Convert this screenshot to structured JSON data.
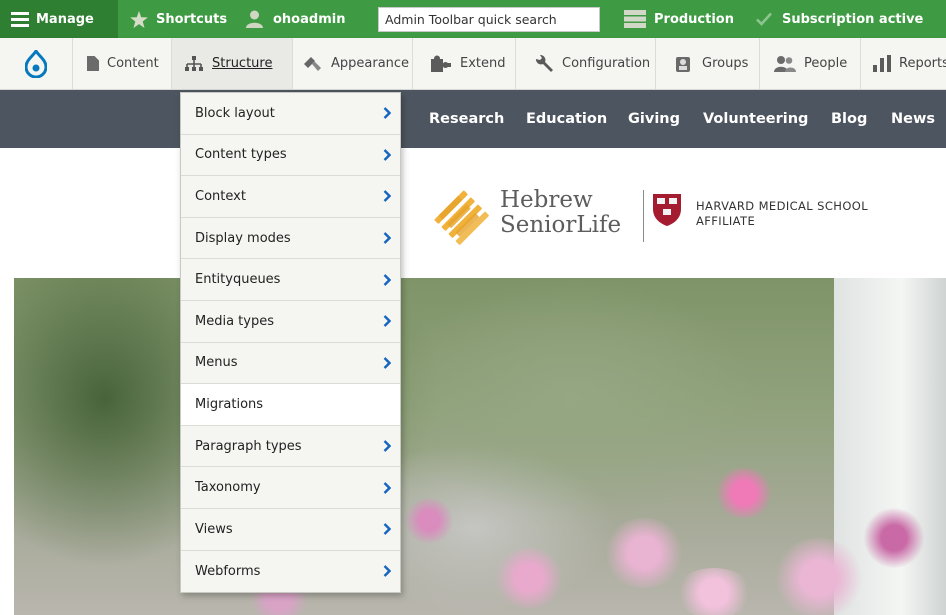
{
  "toolbar": {
    "manage_label": "Manage",
    "shortcuts_label": "Shortcuts",
    "user_label": "ohoadmin",
    "search_placeholder": "Admin Toolbar quick search",
    "environment_label": "Production",
    "subscription_label": "Subscription active"
  },
  "tray": {
    "items": [
      {
        "label": "Content",
        "icon": "file-icon"
      },
      {
        "label": "Structure",
        "icon": "sitemap-icon"
      },
      {
        "label": "Appearance",
        "icon": "paintbrush-icon"
      },
      {
        "label": "Extend",
        "icon": "puzzle-icon"
      },
      {
        "label": "Configuration",
        "icon": "wrench-icon"
      },
      {
        "label": "Groups",
        "icon": "groups-icon"
      },
      {
        "label": "People",
        "icon": "people-icon"
      },
      {
        "label": "Reports",
        "icon": "bar-chart-icon"
      }
    ]
  },
  "site_nav": [
    "Research",
    "Education",
    "Giving",
    "Volunteering",
    "Blog",
    "News"
  ],
  "logo": {
    "hsl_line1": "Hebrew",
    "hsl_line2": "SeniorLife",
    "hms_line1": "HARVARD MEDICAL SCHOOL",
    "hms_line2": "AFFILIATE"
  },
  "structure_menu": {
    "items": [
      {
        "label": "Block layout",
        "has_submenu": true
      },
      {
        "label": "Content types",
        "has_submenu": true
      },
      {
        "label": "Context",
        "has_submenu": true
      },
      {
        "label": "Display modes",
        "has_submenu": true
      },
      {
        "label": "Entityqueues",
        "has_submenu": true
      },
      {
        "label": "Media types",
        "has_submenu": true
      },
      {
        "label": "Menus",
        "has_submenu": true
      },
      {
        "label": "Migrations",
        "has_submenu": false
      },
      {
        "label": "Paragraph types",
        "has_submenu": true
      },
      {
        "label": "Taxonomy",
        "has_submenu": true
      },
      {
        "label": "Views",
        "has_submenu": true
      },
      {
        "label": "Webforms",
        "has_submenu": true
      }
    ],
    "highlighted": "Migrations"
  },
  "colors": {
    "toolbar_green": "#3f9b43",
    "manage_green": "#2f7f33",
    "nav_gray": "#4d5560",
    "chevron_blue": "#1565c0",
    "drupal_blue": "#0678be",
    "hsl_gold": "#f0b23a",
    "harvard_crimson": "#a51c30"
  }
}
